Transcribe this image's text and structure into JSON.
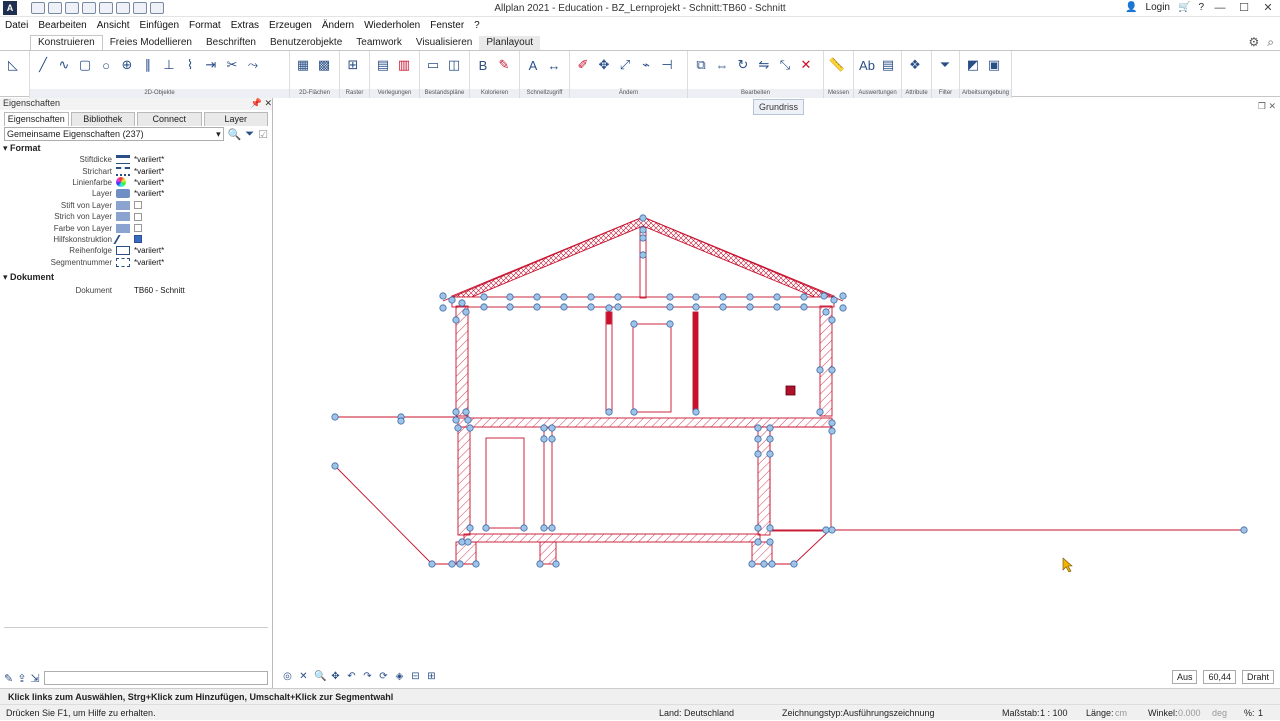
{
  "window": {
    "title": "Allplan 2021 - Education - BZ_Lernprojekt - Schnitt:TB60 - Schnitt",
    "login": "Login"
  },
  "menu": [
    "Datei",
    "Bearbeiten",
    "Ansicht",
    "Einfügen",
    "Format",
    "Extras",
    "Erzeugen",
    "Ändern",
    "Wiederholen",
    "Fenster",
    "?"
  ],
  "ribbon_tabs": [
    "Konstruieren",
    "Freies Modellieren",
    "Beschriften",
    "Benutzerobjekte",
    "Teamwork",
    "Visualisieren",
    "Planlayout"
  ],
  "ribbon_groups": [
    "2D-Objekte",
    "2D-Flächen",
    "Raster",
    "Verlegungen",
    "Bestandspläne",
    "Kolorieren",
    "Schnellzugriff",
    "Ändern",
    "Bearbeiten",
    "Messen",
    "Auswertungen",
    "Attribute",
    "Filter",
    "Arbeitsumgebung"
  ],
  "panel": {
    "title": "Eigenschaften",
    "tabs": [
      "Eigenschaften",
      "Bibliothek",
      "Connect",
      "Layer"
    ],
    "filter": "Gemeinsame Eigenschaften (237)",
    "sections": {
      "format": "Format",
      "document": "Dokument"
    },
    "rows": [
      {
        "label": "Stiftdicke",
        "value": "*variiert*"
      },
      {
        "label": "Strichart",
        "value": "*variiert*"
      },
      {
        "label": "Linienfarbe",
        "value": "*variiert*"
      },
      {
        "label": "Layer",
        "value": "*variiert*"
      },
      {
        "label": "Stift von Layer",
        "value": ""
      },
      {
        "label": "Strich von Layer",
        "value": ""
      },
      {
        "label": "Farbe von Layer",
        "value": ""
      },
      {
        "label": "Hilfskonstruktion",
        "value": ""
      },
      {
        "label": "Reihenfolge",
        "value": "*variiert*"
      },
      {
        "label": "Segmentnummer",
        "value": "*variiert*"
      }
    ],
    "doc_row": {
      "label": "Dokument",
      "value": "TB60 - Schnitt"
    }
  },
  "canvas": {
    "view_button": "Grundriss"
  },
  "view_controls": {
    "mode": "Aus",
    "scale_value": "60,44",
    "render": "Draht"
  },
  "hint": "Klick links zum Auswählen, Strg+Klick zum Hinzufügen, Umschalt+Klick zur Segmentwahl",
  "status": {
    "help": "Drücken Sie F1, um Hilfe zu erhalten.",
    "land_label": "Land:",
    "land_value": "Deutschland",
    "type_label": "Zeichnungstyp:",
    "type_value": "Ausführungszeichnung",
    "scale_label": "Maßstab:",
    "scale_value": "1 : 100",
    "length_label": "Länge:",
    "length_unit": "cm",
    "angle_label": "Winkel:",
    "angle_value": "0.000",
    "angle_unit": "deg",
    "percent_label": "%:",
    "percent_value": "1"
  },
  "colors": {
    "accent": "#2a4f86",
    "drawing": "#c8102e",
    "handle": "#9dc3e6"
  }
}
